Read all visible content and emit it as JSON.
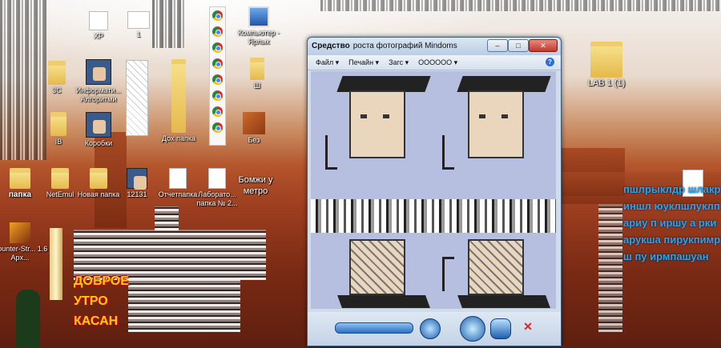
{
  "desktop": {
    "icons": [
      {
        "label": "XP"
      },
      {
        "label": "1"
      },
      {
        "label": "3С"
      },
      {
        "label": "Информати... Алгоритми"
      },
      {
        "label": "IB"
      },
      {
        "label": "Коробки"
      },
      {
        "label": "Дох папка"
      },
      {
        "label": "Компьютер - Ярлык"
      },
      {
        "label": "Ш"
      },
      {
        "label": "Без"
      },
      {
        "label": "папка"
      },
      {
        "label": "NetEmul"
      },
      {
        "label": "Новая папка"
      },
      {
        "label": "12131"
      },
      {
        "label": "Отчетпапка"
      },
      {
        "label": "Лаборато... папка № 2..."
      },
      {
        "label": "Бомжи у метро"
      },
      {
        "label": "Counter-Str... 1.6 Арх..."
      },
      {
        "label": "LAB 1 (1)"
      }
    ],
    "right_text": "пшлрыклдр шлакриншл юуклшлуклп ариу п иршу а ркиарукша пирукпимрш пу ирмпашуан",
    "overlay_text": "ДОБРОЕ УТРО КАСАН"
  },
  "viewer": {
    "title_main": "Средство",
    "title_rest": "роста фотографий Mindoms",
    "menu": {
      "file": "Файл",
      "print": "Печайн",
      "burn": "Загс",
      "open": "OOOOOO"
    },
    "buttons": {
      "minimize": "–",
      "maximize": "□",
      "close": "✕",
      "help": "?"
    }
  }
}
